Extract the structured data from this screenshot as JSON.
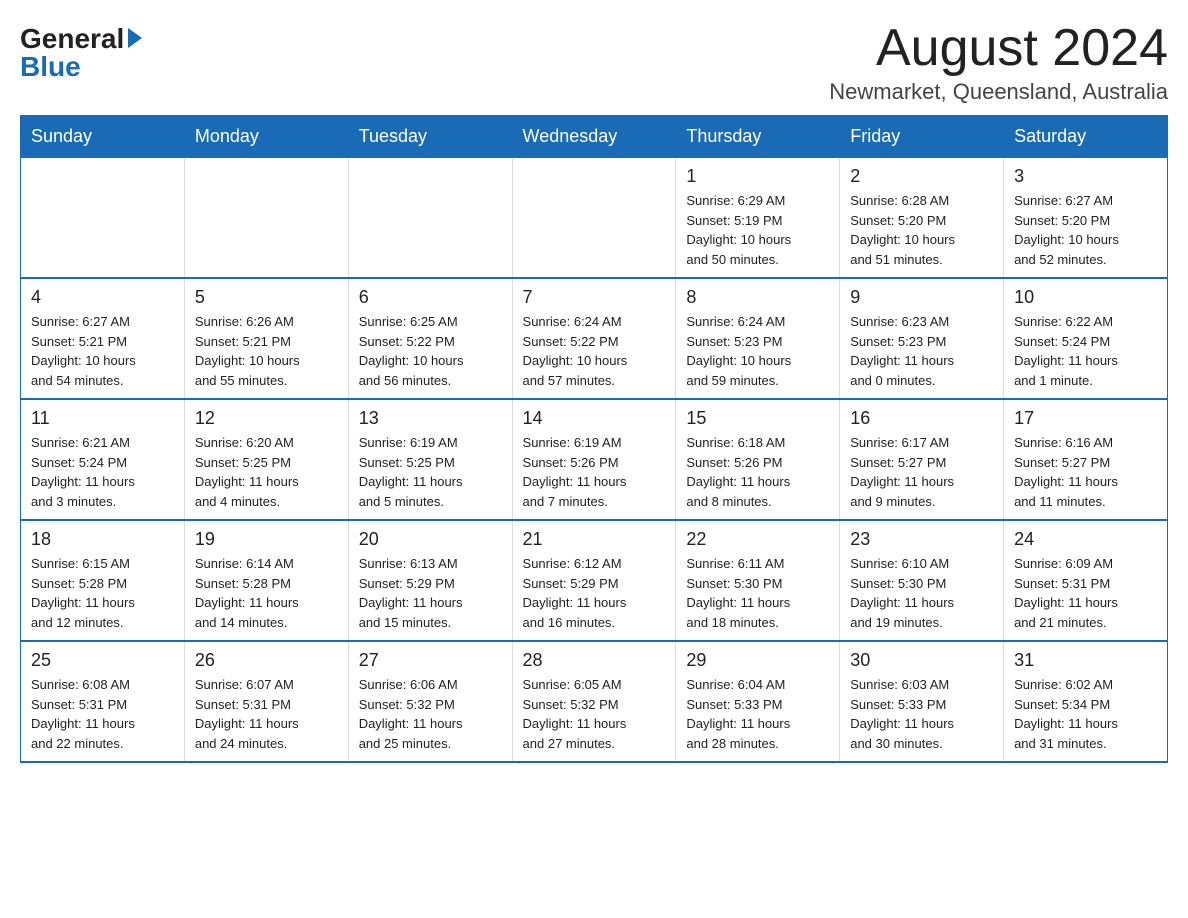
{
  "logo": {
    "general": "General",
    "blue": "Blue"
  },
  "header": {
    "month_year": "August 2024",
    "location": "Newmarket, Queensland, Australia"
  },
  "days_of_week": [
    "Sunday",
    "Monday",
    "Tuesday",
    "Wednesday",
    "Thursday",
    "Friday",
    "Saturday"
  ],
  "weeks": [
    {
      "days": [
        {
          "number": "",
          "info": ""
        },
        {
          "number": "",
          "info": ""
        },
        {
          "number": "",
          "info": ""
        },
        {
          "number": "",
          "info": ""
        },
        {
          "number": "1",
          "info": "Sunrise: 6:29 AM\nSunset: 5:19 PM\nDaylight: 10 hours\nand 50 minutes."
        },
        {
          "number": "2",
          "info": "Sunrise: 6:28 AM\nSunset: 5:20 PM\nDaylight: 10 hours\nand 51 minutes."
        },
        {
          "number": "3",
          "info": "Sunrise: 6:27 AM\nSunset: 5:20 PM\nDaylight: 10 hours\nand 52 minutes."
        }
      ]
    },
    {
      "days": [
        {
          "number": "4",
          "info": "Sunrise: 6:27 AM\nSunset: 5:21 PM\nDaylight: 10 hours\nand 54 minutes."
        },
        {
          "number": "5",
          "info": "Sunrise: 6:26 AM\nSunset: 5:21 PM\nDaylight: 10 hours\nand 55 minutes."
        },
        {
          "number": "6",
          "info": "Sunrise: 6:25 AM\nSunset: 5:22 PM\nDaylight: 10 hours\nand 56 minutes."
        },
        {
          "number": "7",
          "info": "Sunrise: 6:24 AM\nSunset: 5:22 PM\nDaylight: 10 hours\nand 57 minutes."
        },
        {
          "number": "8",
          "info": "Sunrise: 6:24 AM\nSunset: 5:23 PM\nDaylight: 10 hours\nand 59 minutes."
        },
        {
          "number": "9",
          "info": "Sunrise: 6:23 AM\nSunset: 5:23 PM\nDaylight: 11 hours\nand 0 minutes."
        },
        {
          "number": "10",
          "info": "Sunrise: 6:22 AM\nSunset: 5:24 PM\nDaylight: 11 hours\nand 1 minute."
        }
      ]
    },
    {
      "days": [
        {
          "number": "11",
          "info": "Sunrise: 6:21 AM\nSunset: 5:24 PM\nDaylight: 11 hours\nand 3 minutes."
        },
        {
          "number": "12",
          "info": "Sunrise: 6:20 AM\nSunset: 5:25 PM\nDaylight: 11 hours\nand 4 minutes."
        },
        {
          "number": "13",
          "info": "Sunrise: 6:19 AM\nSunset: 5:25 PM\nDaylight: 11 hours\nand 5 minutes."
        },
        {
          "number": "14",
          "info": "Sunrise: 6:19 AM\nSunset: 5:26 PM\nDaylight: 11 hours\nand 7 minutes."
        },
        {
          "number": "15",
          "info": "Sunrise: 6:18 AM\nSunset: 5:26 PM\nDaylight: 11 hours\nand 8 minutes."
        },
        {
          "number": "16",
          "info": "Sunrise: 6:17 AM\nSunset: 5:27 PM\nDaylight: 11 hours\nand 9 minutes."
        },
        {
          "number": "17",
          "info": "Sunrise: 6:16 AM\nSunset: 5:27 PM\nDaylight: 11 hours\nand 11 minutes."
        }
      ]
    },
    {
      "days": [
        {
          "number": "18",
          "info": "Sunrise: 6:15 AM\nSunset: 5:28 PM\nDaylight: 11 hours\nand 12 minutes."
        },
        {
          "number": "19",
          "info": "Sunrise: 6:14 AM\nSunset: 5:28 PM\nDaylight: 11 hours\nand 14 minutes."
        },
        {
          "number": "20",
          "info": "Sunrise: 6:13 AM\nSunset: 5:29 PM\nDaylight: 11 hours\nand 15 minutes."
        },
        {
          "number": "21",
          "info": "Sunrise: 6:12 AM\nSunset: 5:29 PM\nDaylight: 11 hours\nand 16 minutes."
        },
        {
          "number": "22",
          "info": "Sunrise: 6:11 AM\nSunset: 5:30 PM\nDaylight: 11 hours\nand 18 minutes."
        },
        {
          "number": "23",
          "info": "Sunrise: 6:10 AM\nSunset: 5:30 PM\nDaylight: 11 hours\nand 19 minutes."
        },
        {
          "number": "24",
          "info": "Sunrise: 6:09 AM\nSunset: 5:31 PM\nDaylight: 11 hours\nand 21 minutes."
        }
      ]
    },
    {
      "days": [
        {
          "number": "25",
          "info": "Sunrise: 6:08 AM\nSunset: 5:31 PM\nDaylight: 11 hours\nand 22 minutes."
        },
        {
          "number": "26",
          "info": "Sunrise: 6:07 AM\nSunset: 5:31 PM\nDaylight: 11 hours\nand 24 minutes."
        },
        {
          "number": "27",
          "info": "Sunrise: 6:06 AM\nSunset: 5:32 PM\nDaylight: 11 hours\nand 25 minutes."
        },
        {
          "number": "28",
          "info": "Sunrise: 6:05 AM\nSunset: 5:32 PM\nDaylight: 11 hours\nand 27 minutes."
        },
        {
          "number": "29",
          "info": "Sunrise: 6:04 AM\nSunset: 5:33 PM\nDaylight: 11 hours\nand 28 minutes."
        },
        {
          "number": "30",
          "info": "Sunrise: 6:03 AM\nSunset: 5:33 PM\nDaylight: 11 hours\nand 30 minutes."
        },
        {
          "number": "31",
          "info": "Sunrise: 6:02 AM\nSunset: 5:34 PM\nDaylight: 11 hours\nand 31 minutes."
        }
      ]
    }
  ]
}
